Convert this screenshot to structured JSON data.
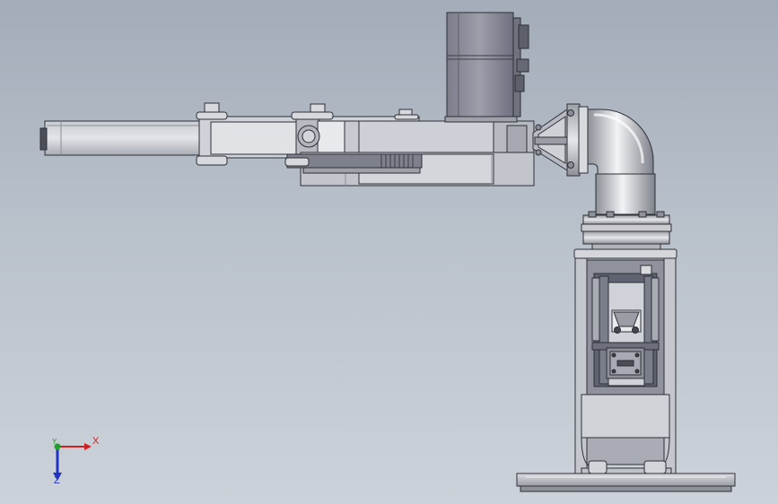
{
  "viewport": {
    "background_top": "#a3acb9",
    "background_bottom": "#ccd2d9",
    "model_colors": {
      "metal_light": "#d9dce2",
      "metal_mid": "#b5b8c0",
      "metal_dark": "#6b6e78",
      "motor_gray": "#888a96",
      "outline": "#2e3036"
    }
  },
  "triad": {
    "x_label": "X",
    "y_label": "Y",
    "z_label": "Z",
    "x_color": "#d12020",
    "y_color": "#1fa02a",
    "z_color": "#2233c4"
  }
}
